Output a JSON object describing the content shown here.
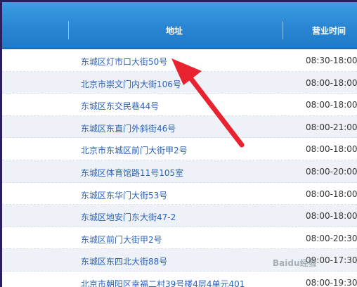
{
  "table": {
    "columns": [
      "地址",
      "营业时间"
    ],
    "rows": [
      {
        "address": "东城区灯市口大街50号",
        "hours": "08:30-18:00"
      },
      {
        "address": "北京市崇文门内大街106号",
        "hours": "08:00-18:00"
      },
      {
        "address": "东城区东交民巷44号",
        "hours": "08:00-18:00"
      },
      {
        "address": "东城区东直门外斜街46号",
        "hours": "08:00-21:00"
      },
      {
        "address": "北京市东城区前门大街甲2号",
        "hours": "08:00-18:00"
      },
      {
        "address": "东城区体育馆路11号105室",
        "hours": "08:00-20:00"
      },
      {
        "address": "东城区东华门大街53号",
        "hours": "08:00-18:00"
      },
      {
        "address": "东城区地安门东大街47-2",
        "hours": "08:00-18:00"
      },
      {
        "address": "东城区前门大街甲2号",
        "hours": "08:00-20:30"
      },
      {
        "address": "东城区东四北大街88号",
        "hours": "09:00-17:30"
      },
      {
        "address": "北京市朝阳区幸福二村39号楼4层4单元401",
        "hours": "08:00-19:30"
      }
    ]
  },
  "watermark": "Baidu经验",
  "colors": {
    "header": "#2a86d3",
    "link": "#2c62b5",
    "arrow": "#e8222e",
    "border": "#2a1f5c"
  }
}
